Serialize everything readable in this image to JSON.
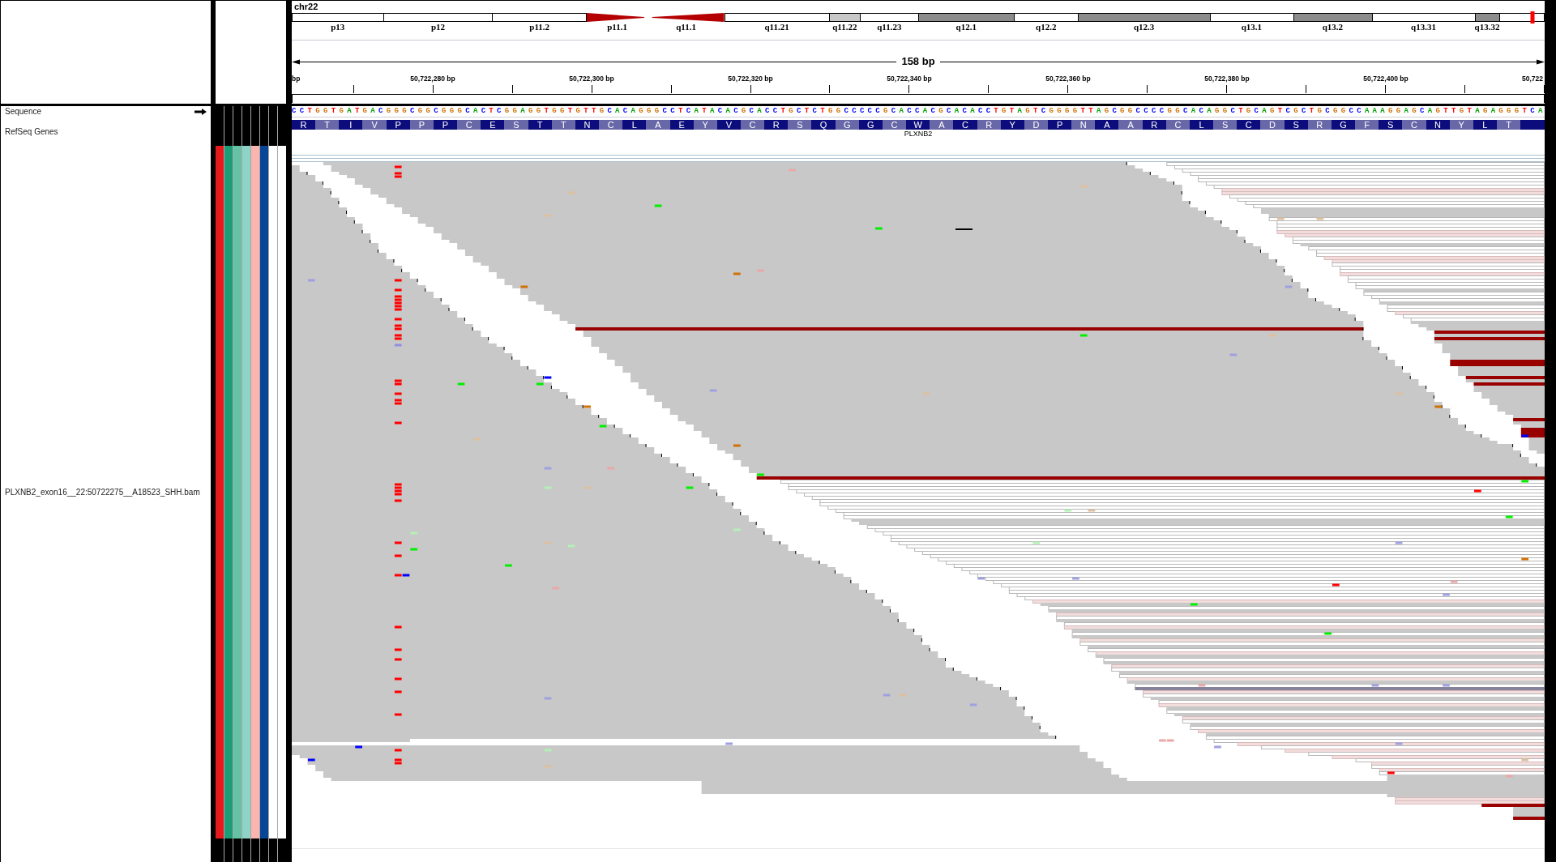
{
  "ideogram": {
    "chromosome": "chr22",
    "bands": [
      {
        "label": "p13",
        "kind": "band",
        "color": "#ffffff"
      },
      {
        "label": "p12",
        "kind": "band",
        "color": "#ffffff"
      },
      {
        "label": "p11.2",
        "kind": "band",
        "color": "#ffffff"
      },
      {
        "label": "p11.1",
        "kind": "centromere",
        "color": "#b40000"
      },
      {
        "label": "q11.1",
        "kind": "centromere",
        "color": "#b40000"
      },
      {
        "label": "q11.21",
        "kind": "band",
        "color": "#ffffff"
      },
      {
        "label": "q11.22",
        "kind": "band",
        "color": "#c8c8c8"
      },
      {
        "label": "q11.23",
        "kind": "band",
        "color": "#ffffff"
      },
      {
        "label": "q12.1",
        "kind": "band",
        "color": "#8c8c8c"
      },
      {
        "label": "q12.2",
        "kind": "band",
        "color": "#ffffff"
      },
      {
        "label": "q12.3",
        "kind": "band",
        "color": "#8c8c8c"
      },
      {
        "label": "q13.1",
        "kind": "band",
        "color": "#ffffff"
      },
      {
        "label": "q13.2",
        "kind": "band",
        "color": "#8c8c8c"
      },
      {
        "label": "q13.31",
        "kind": "band",
        "color": "#ffffff"
      },
      {
        "label": "q13.32",
        "kind": "band",
        "color": "#8c8c8c"
      },
      {
        "kind": "band",
        "color": "#ffffff"
      }
    ],
    "current_view": {
      "level": 0.99
    }
  },
  "ruler": {
    "span": "158 bp",
    "ticks": [
      "bp",
      "50,722,280 bp",
      "50,722,300 bp",
      "50,722,320 bp",
      "50,722,340 bp",
      "50,722,360 bp",
      "50,722,380 bp",
      "50,722,400 bp",
      "50,722"
    ]
  },
  "tracks": [
    {
      "kind": "sequence",
      "name": "Sequence",
      "forward_strand": true,
      "bases": "CCTGGTGATGACGGGCGGCGGGCACTCGGAGGTGGTGTTGCACAGGGCCTCATACACGCACCTGCTCTGGCCCCCGCACCACGCACACCTGTAGTCGGGGTTAGCGGCCCCGGCACAGGCTGCAGTCGCTGCGGCCAAAGGAGCAGTTGTAGAGGGTCA"
    },
    {
      "kind": "gene",
      "name": "RefSeq Genes",
      "gene": "PLXNB2",
      "amino_acids": [
        "R",
        "T",
        "I",
        "V",
        "P",
        "P",
        "P",
        "C",
        "E",
        "S",
        "T",
        "T",
        "N",
        "C",
        "L",
        "A",
        "E",
        "Y",
        "V",
        "C",
        "R",
        "S",
        "Q",
        "G",
        "G",
        "C",
        "W",
        "A",
        "C",
        "R",
        "Y",
        "D",
        "P",
        "N",
        "A",
        "A",
        "R",
        "C",
        "L",
        "S",
        "C",
        "D",
        "S",
        "R",
        "G",
        "F",
        "S",
        "C",
        "N",
        "Y",
        "L",
        "T"
      ]
    },
    {
      "kind": "alignment",
      "name": "PLXNB2_exon16__22:50722275__A18523_SHH.bam",
      "attributes": [
        {
          "color": "#e41a1c"
        },
        {
          "color": "#1b9e77"
        },
        {
          "color": "#66c2a5"
        },
        {
          "color": "#8dd3c7"
        },
        {
          "color": "#fbb4ae"
        },
        {
          "color": "#084594"
        },
        {
          "color": "#ffffff"
        },
        {
          "color": "#ffffff"
        }
      ]
    }
  ]
}
